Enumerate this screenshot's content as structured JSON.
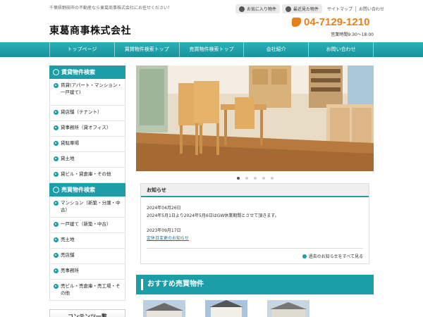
{
  "header": {
    "tagline": "千葉県野田市の不動産なら東葛商事株式会社にお任せください！",
    "favorites": "お気に入り物件",
    "recent": "最近見た物件",
    "sitemap": "サイトマップ",
    "contact_link": "お問い合わせ",
    "logo": "東葛商事株式会社",
    "phone": "04-7129-1210",
    "hours": "営業時間9:30～18:00"
  },
  "nav": [
    "トップページ",
    "賃貸物件検索トップ",
    "売買物件検索トップ",
    "会社紹介",
    "お問い合わせ"
  ],
  "sidebar": {
    "rental_title": "賃貸物件検索",
    "rental_items": [
      "賃貸(アパート・マンション・一戸建て)",
      "貸店舗（テナント）",
      "貸事務所（貸オフィス）",
      "貸駐車場",
      "貸土地",
      "貸ビル・貸倉庫・その他"
    ],
    "sale_title": "売買物件検索",
    "sale_items": [
      "マンション（新築・分譲・中古）",
      "一戸建て（新築・中古）",
      "売土地",
      "売店舗",
      "売事務所",
      "売ビル・売倉庫・売工場・その他"
    ],
    "contents_title": "コンテンツ一覧"
  },
  "news": {
    "title": "お知らせ",
    "items": [
      {
        "date": "2024年04月26日",
        "text": "2024年5月1日より2024年5月6日はGW休業期間とさせて頂きます。"
      },
      {
        "date": "2023年09月17日",
        "text": "定休日変更のお知らせ"
      }
    ],
    "more": "過去のお知らせをすべて見る"
  },
  "recommend": {
    "title": "おすすめ売買物件"
  },
  "colors": {
    "accent": "#1b9ea7",
    "phone": "#e8801a"
  }
}
